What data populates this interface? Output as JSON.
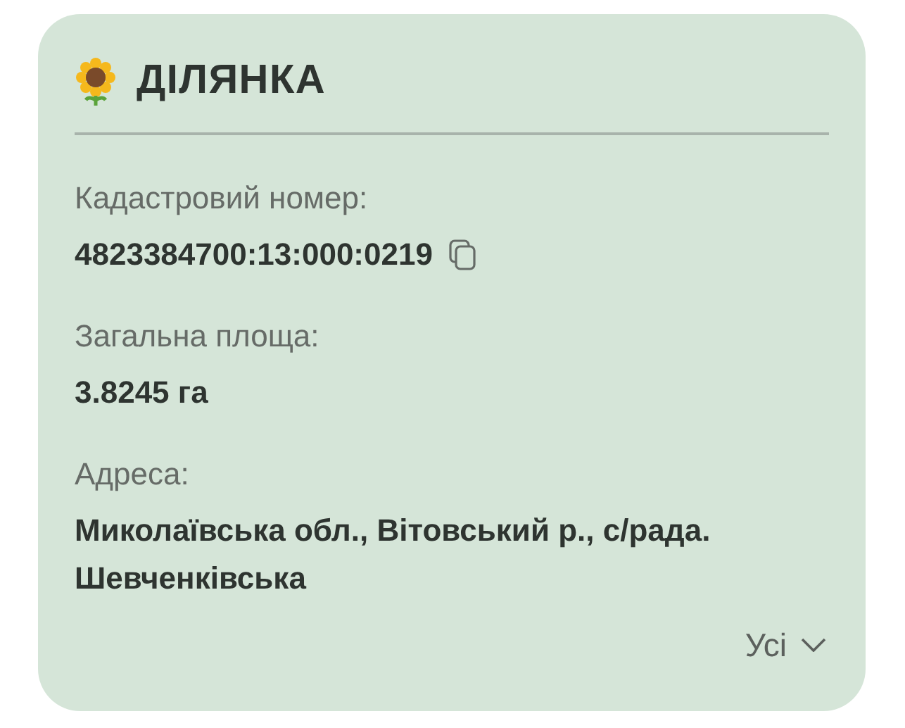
{
  "card": {
    "title": "ДІЛЯНКА",
    "fields": [
      {
        "label": "Кадастровий номер:",
        "value": "4823384700:13:000:0219",
        "kind": "copyable"
      },
      {
        "label": "Загальна площа:",
        "value": "3.8245 га",
        "kind": "plain"
      },
      {
        "label": "Адреса:",
        "value": "Миколаївська обл., Вітовський р., с/рада. Шевченківська",
        "kind": "plain"
      }
    ],
    "more_button": {
      "label": "Усі"
    }
  }
}
